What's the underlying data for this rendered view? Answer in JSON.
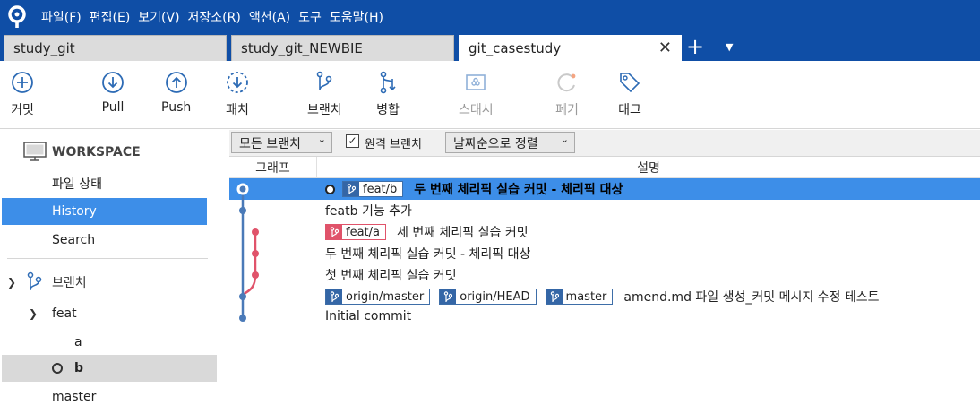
{
  "menu": [
    "파일(F)",
    "편집(E)",
    "보기(V)",
    "저장소(R)",
    "액션(A)",
    "도구",
    "도움말(H)"
  ],
  "tabs": [
    {
      "label": "study_git"
    },
    {
      "label": "study_git_NEWBIE"
    },
    {
      "label": "git_casestudy",
      "active": true
    }
  ],
  "toolbar": {
    "commit": "커밋",
    "pull": "Pull",
    "push": "Push",
    "patch": "패치",
    "branch": "브랜치",
    "merge": "병합",
    "stash": "스태시",
    "discard": "폐기",
    "tag": "태그"
  },
  "sidebar": {
    "workspace": "WORKSPACE",
    "items": [
      "파일 상태",
      "History",
      "Search"
    ],
    "branches_title": "브랜치",
    "branch_groups": [
      {
        "name": "feat",
        "children": [
          "a",
          "b"
        ]
      }
    ],
    "branches": [
      "master"
    ]
  },
  "filter": {
    "branches": "모든 브랜치",
    "remote": "원격 브랜치",
    "sort": "날짜순으로 정렬"
  },
  "table": {
    "col_graph": "그래프",
    "col_desc": "설명"
  },
  "commits": [
    {
      "refs": [
        {
          "name": "feat/b",
          "color": "blue"
        }
      ],
      "message": "두 번째 체리픽 실습 커밋 - 체리픽 대상",
      "head": true
    },
    {
      "refs": [],
      "message": "featb 기능 추가"
    },
    {
      "refs": [
        {
          "name": "feat/a",
          "color": "pink"
        }
      ],
      "message": "세 번째 체리픽 실습 커밋"
    },
    {
      "refs": [],
      "message": "두 번째 체리픽 실습 커밋 - 체리픽 대상"
    },
    {
      "refs": [],
      "message": "첫 번째 체리픽 실습 커밋"
    },
    {
      "refs": [
        {
          "name": "origin/master",
          "color": "blue"
        },
        {
          "name": "origin/HEAD",
          "color": "blue"
        },
        {
          "name": "master",
          "color": "blue"
        }
      ],
      "message": "amend.md 파일 생성_커밋 메시지 수정 테스트"
    },
    {
      "refs": [],
      "message": "Initial commit"
    }
  ],
  "colors": {
    "brand": "#0f4ea6",
    "selection": "#3d8ee8",
    "branch_blue": "#3466a6",
    "branch_pink": "#e0536a",
    "graph_blue": "#4a7ab8",
    "graph_pink": "#e0536a"
  }
}
